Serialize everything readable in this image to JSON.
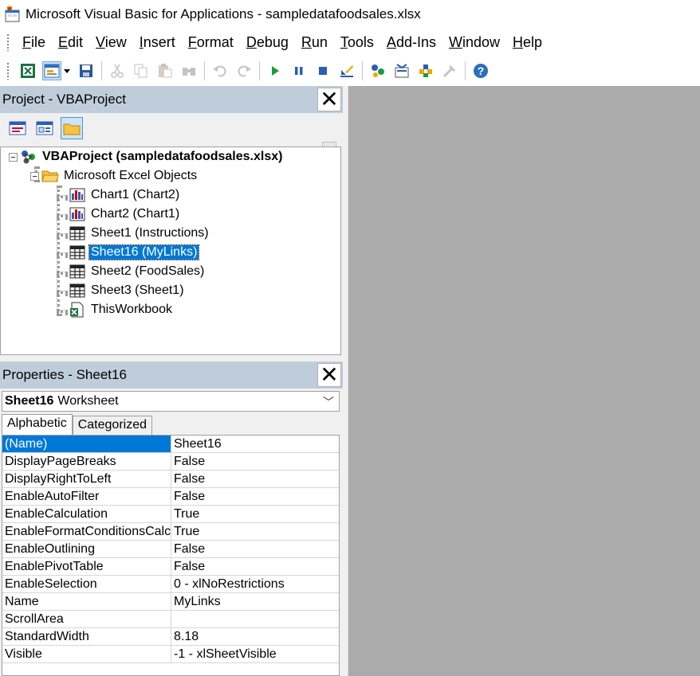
{
  "window": {
    "title": "Microsoft Visual Basic for Applications - sampledatafoodsales.xlsx"
  },
  "menu": [
    {
      "label": "File",
      "ul": "F",
      "rest": "ile"
    },
    {
      "label": "Edit",
      "ul": "E",
      "rest": "dit"
    },
    {
      "label": "View",
      "ul": "V",
      "rest": "iew"
    },
    {
      "label": "Insert",
      "ul": "I",
      "rest": "nsert"
    },
    {
      "label": "Format",
      "ul": "F",
      "rest": "ormat"
    },
    {
      "label": "Debug",
      "ul": "D",
      "rest": "ebug"
    },
    {
      "label": "Run",
      "ul": "R",
      "rest": "un"
    },
    {
      "label": "Tools",
      "ul": "T",
      "rest": "ools"
    },
    {
      "label": "Add-Ins",
      "ul": "A",
      "rest": "dd-Ins"
    },
    {
      "label": "Window",
      "ul": "W",
      "rest": "indow"
    },
    {
      "label": "Help",
      "ul": "H",
      "rest": "elp"
    }
  ],
  "toolbar_icons": [
    "view-excel-icon",
    "insert-userform-icon",
    "dropdown-arrow-icon",
    "save-icon",
    "cut-icon",
    "copy-icon",
    "paste-icon",
    "find-icon",
    "undo-icon",
    "redo-icon",
    "run-icon",
    "break-icon",
    "reset-icon",
    "design-mode-icon",
    "project-explorer-icon",
    "properties-window-icon",
    "object-browser-icon",
    "toolbox-icon",
    "help-icon"
  ],
  "project": {
    "title": "Project - VBAProject",
    "root": "VBAProject (sampledatafoodsales.xlsx)",
    "folder": "Microsoft Excel Objects",
    "items": [
      {
        "label": "Chart1 (Chart2)",
        "icon": "chart-icon"
      },
      {
        "label": "Chart2 (Chart1)",
        "icon": "chart-icon"
      },
      {
        "label": "Sheet1 (Instructions)",
        "icon": "sheet-icon"
      },
      {
        "label": "Sheet16 (MyLinks)",
        "icon": "sheet-icon",
        "selected": true
      },
      {
        "label": "Sheet2 (FoodSales)",
        "icon": "sheet-icon"
      },
      {
        "label": "Sheet3 (Sheet1)",
        "icon": "sheet-icon"
      },
      {
        "label": "ThisWorkbook",
        "icon": "workbook-icon"
      }
    ]
  },
  "properties": {
    "title": "Properties - Sheet16",
    "object_name": "Sheet16",
    "object_type": "Worksheet",
    "tabs": [
      "Alphabetic",
      "Categorized"
    ],
    "rows": [
      {
        "name": "(Name)",
        "value": "Sheet16"
      },
      {
        "name": "DisplayPageBreaks",
        "value": "False"
      },
      {
        "name": "DisplayRightToLeft",
        "value": "False"
      },
      {
        "name": "EnableAutoFilter",
        "value": "False"
      },
      {
        "name": "EnableCalculation",
        "value": "True"
      },
      {
        "name": "EnableFormatConditionsCalculation",
        "value": "True"
      },
      {
        "name": "EnableOutlining",
        "value": "False"
      },
      {
        "name": "EnablePivotTable",
        "value": "False"
      },
      {
        "name": "EnableSelection",
        "value": "0 - xlNoRestrictions"
      },
      {
        "name": "Name",
        "value": "MyLinks"
      },
      {
        "name": "ScrollArea",
        "value": ""
      },
      {
        "name": "StandardWidth",
        "value": "8.18"
      },
      {
        "name": "Visible",
        "value": "-1 - xlSheetVisible"
      }
    ]
  },
  "close_glyph": "✕",
  "combo_chevron": "﹀"
}
